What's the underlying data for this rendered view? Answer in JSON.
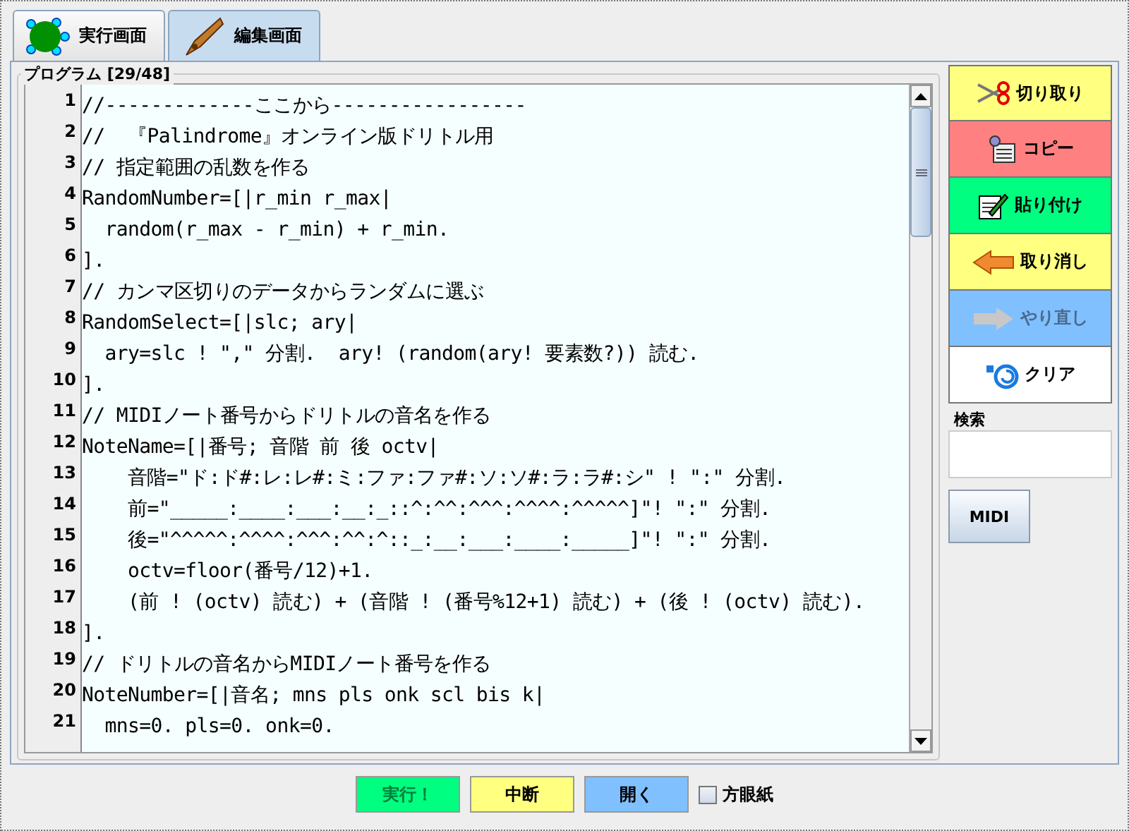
{
  "tabs": [
    {
      "label": "実行画面",
      "selected": false,
      "kind": "turtle"
    },
    {
      "label": "編集画面",
      "selected": true,
      "kind": "pen"
    }
  ],
  "program": {
    "title": "プログラム [29/48]",
    "lines": [
      {
        "number": "1",
        "text": "//-------------ここから-----------------"
      },
      {
        "number": "2",
        "text": "//  『Palindrome』オンライン版ドリトル用"
      },
      {
        "number": "3",
        "text": "// 指定範囲の乱数を作る"
      },
      {
        "number": "4",
        "text": "RandomNumber=[|r_min r_max|"
      },
      {
        "number": "5",
        "text": "  random(r_max - r_min) + r_min."
      },
      {
        "number": "6",
        "text": "]."
      },
      {
        "number": "7",
        "text": "// カンマ区切りのデータからランダムに選ぶ"
      },
      {
        "number": "8",
        "text": "RandomSelect=[|slc; ary|"
      },
      {
        "number": "9",
        "text": "  ary=slc ! \",\" 分割.  ary! (random(ary! 要素数?)) 読む."
      },
      {
        "number": "10",
        "text": "]."
      },
      {
        "number": "11",
        "text": "// MIDIノート番号からドリトルの音名を作る"
      },
      {
        "number": "12",
        "text": "NoteName=[|番号; 音階 前 後 octv|"
      },
      {
        "number": "13",
        "text": "    音階=\"ド:ド#:レ:レ#:ミ:ファ:ファ#:ソ:ソ#:ラ:ラ#:シ\" ! \":\" 分割."
      },
      {
        "number": "14",
        "text": "    前=\"_____:____:___:__:_::^:^^:^^^:^^^^:^^^^^]\"! \":\" 分割."
      },
      {
        "number": "15",
        "text": "    後=\"^^^^^:^^^^:^^^:^^:^::_:__:___:____:_____]\"! \":\" 分割."
      },
      {
        "number": "16",
        "text": "    octv=floor(番号/12)+1."
      },
      {
        "number": "17",
        "text": "    (前 ! (octv) 読む) + (音階 ! (番号%12+1) 読む) + (後 ! (octv) 読む)."
      },
      {
        "number": "18",
        "text": "]."
      },
      {
        "number": "19",
        "text": "// ドリトルの音名からMIDIノート番号を作る"
      },
      {
        "number": "20",
        "text": "NoteNumber=[|音名; mns pls onk scl bis k|"
      },
      {
        "number": "21",
        "text": "  mns=0. pls=0. onk=0."
      }
    ]
  },
  "tools": [
    {
      "label": "切り取り",
      "kind": "scissors",
      "color": "#ffff80",
      "disabled": false
    },
    {
      "label": "コピー",
      "kind": "copy",
      "color": "#ff8080",
      "disabled": false
    },
    {
      "label": "貼り付け",
      "kind": "paste",
      "color": "#00ff80",
      "disabled": false
    },
    {
      "label": "取り消し",
      "kind": "undo",
      "color": "#ffff80",
      "disabled": false
    },
    {
      "label": "やり直し",
      "kind": "redo",
      "color": "#80c0ff",
      "disabled": true
    },
    {
      "label": "クリア",
      "kind": "clear",
      "color": "#ffffff",
      "disabled": false
    }
  ],
  "search": {
    "title": "検索"
  },
  "midi_button": "MIDI",
  "bottom_buttons": [
    {
      "label": "実行！",
      "color": "#00ff80",
      "disabled": true
    },
    {
      "label": "中断",
      "color": "#ffff80",
      "disabled": false
    },
    {
      "label": "開く",
      "color": "#80c0ff",
      "disabled": false
    }
  ],
  "grid_paper": {
    "label": "方眼紙",
    "checked": false
  }
}
